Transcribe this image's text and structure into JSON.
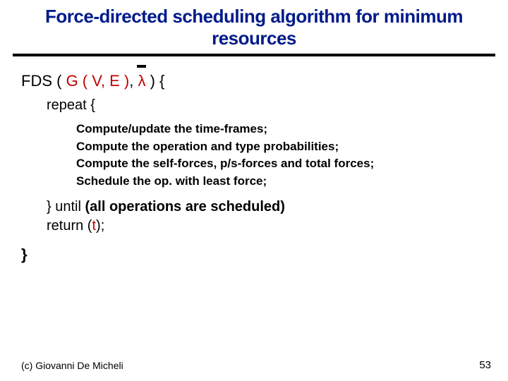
{
  "title": "Force-directed scheduling algorithm for minimum resources",
  "sig": {
    "prefix": "FDS ( ",
    "g": "G ( V, E )",
    "mid": ",  ",
    "lambda": "λ",
    "suffix": " ) {"
  },
  "repeat": "repeat {",
  "steps": [
    "Compute/update the time-frames;",
    "Compute the operation and type probabilities;",
    "Compute the self-forces, p/s-forces and total forces;",
    "Schedule the op. with least force;"
  ],
  "until_prefix": "} until ",
  "until_cond": "(all operations are scheduled)",
  "return_prefix": "return (",
  "return_var": "t",
  "return_suffix": ");",
  "close": "}",
  "copyright": "(c)  Giovanni De Micheli",
  "page": "53"
}
